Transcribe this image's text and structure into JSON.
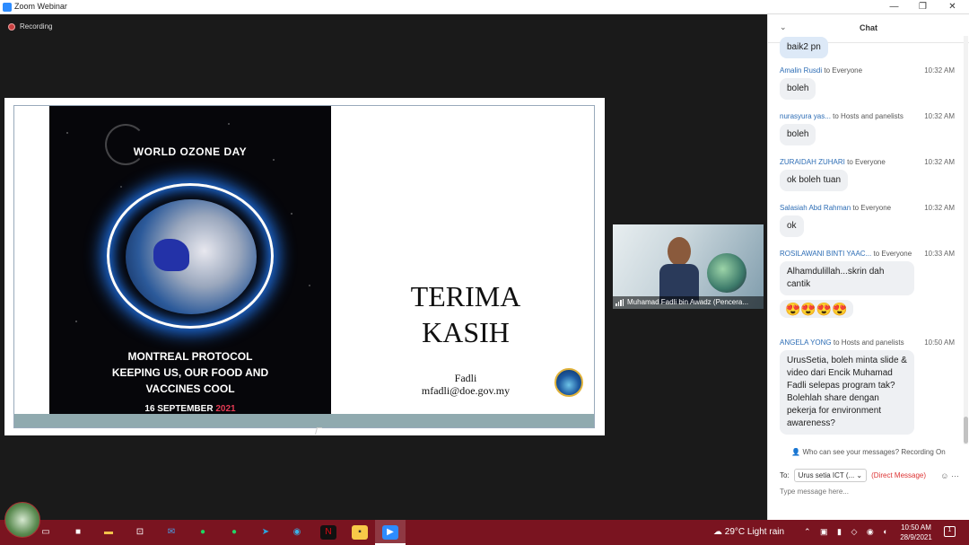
{
  "window": {
    "title": "Zoom Webinar"
  },
  "recording": {
    "label": "Recording"
  },
  "slide": {
    "poster_heading": "WORLD OZONE DAY",
    "poster_sub": [
      "MONTREAL PROTOCOL",
      "KEEPING US, OUR FOOD AND",
      "VACCINES COOL"
    ],
    "poster_date_day": "16 SEPTEMBER",
    "poster_date_year": "2021",
    "thanks_line1": "TERIMA",
    "thanks_line2": "KASIH",
    "presenter_name": "Fadli",
    "presenter_email": "mfadli@doe.gov.my"
  },
  "video": {
    "name": "Muhamad Fadli bin Awadz (Pencera..."
  },
  "chat": {
    "title": "Chat",
    "first_partial": "baik2 pn",
    "messages": [
      {
        "sender": "Amalin Rusdi",
        "to": "to Everyone",
        "time": "10:32 AM",
        "text": "boleh"
      },
      {
        "sender": "nurasyura yas...",
        "to": "to Hosts and panelists",
        "time": "10:32 AM",
        "text": "boleh"
      },
      {
        "sender": "ZURAIDAH ZUHARI",
        "to": "to Everyone",
        "time": "10:32 AM",
        "text": "ok boleh tuan"
      },
      {
        "sender": "Salasiah Abd Rahman",
        "to": "to Everyone",
        "time": "10:32 AM",
        "text": "ok"
      },
      {
        "sender": "ROSILAWANI BINTI YAAC...",
        "to": "to Everyone",
        "time": "10:33 AM",
        "text": "Alhamdulillah...skrin dah cantik"
      },
      {
        "sender": "",
        "to": "",
        "time": "",
        "text": "😍😍😍😍"
      },
      {
        "sender": "ANGELA YONG",
        "to": "to Hosts and panelists",
        "time": "10:50 AM",
        "text": "UrusSetia, boleh minta slide & video dari Encik Muhamad Fadli selepas program tak? Bolehlah share dengan pekerja for environment awareness?"
      }
    ],
    "who_can_see": "Who can see your messages? Recording On",
    "to_label": "To:",
    "to_value": "Urus setia ICT (...",
    "direct_message": "(Direct Message)",
    "input_placeholder": "Type message here..."
  },
  "taskbar": {
    "weather": "29°C  Light rain",
    "time": "10:50 AM",
    "date": "28/9/2021",
    "notification_count": "1"
  }
}
